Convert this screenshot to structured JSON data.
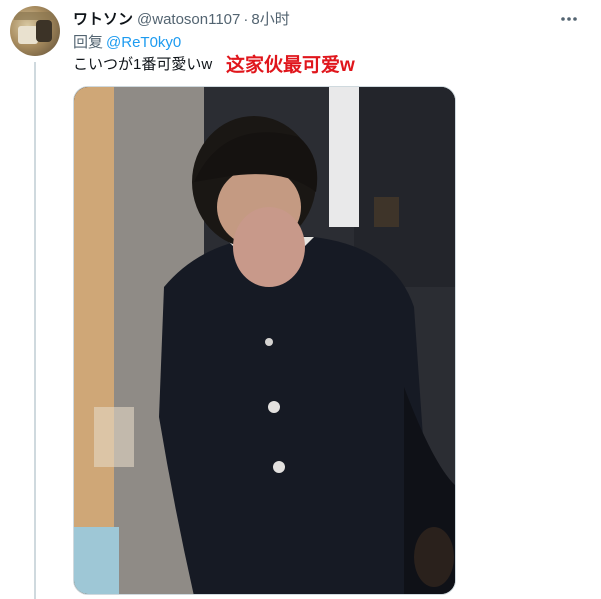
{
  "tweet": {
    "author": {
      "display_name": "ワトソン",
      "handle": "@watoson1107",
      "separator": "·",
      "time": "8小时"
    },
    "reply": {
      "prefix": "回复",
      "mention": "@ReT0ky0"
    },
    "text": "こいつが1番可愛いw",
    "annotation": "这家伙最可爱w",
    "icons": {
      "more": "more-horizontal-icon"
    },
    "colors": {
      "accent": "#1d9bf0",
      "annotation": "#e0161c",
      "text": "#0f1419",
      "muted": "#536471"
    }
  }
}
